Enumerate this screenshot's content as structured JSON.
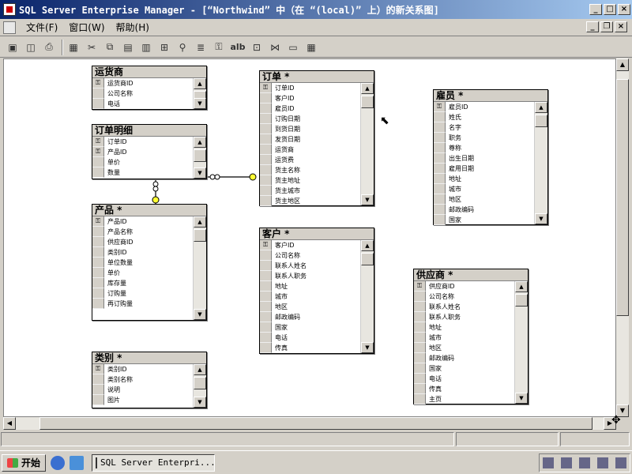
{
  "window": {
    "title": "SQL Server Enterprise Manager - [“Northwind” 中（在 “(local)” 上）的新关系图]",
    "min": "_",
    "max": "□",
    "close": "×"
  },
  "menu": {
    "items": [
      "文件(F)",
      "窗口(W)",
      "帮助(H)"
    ]
  },
  "mdi": {
    "min": "_",
    "restore": "❐",
    "close": "×"
  },
  "toolbar": {
    "icons": [
      "save-icon",
      "properties-icon",
      "print-icon",
      "new-table-icon",
      "cut-icon",
      "copy-icon",
      "paste-icon",
      "add-table-icon",
      "add-related-icon",
      "zoom-icon",
      "script-icon",
      "key-icon",
      "label-icon",
      "arrange-icon",
      "relationship-icon",
      "table-view-icon",
      "grid-icon"
    ],
    "label_text": "alb"
  },
  "tables": [
    {
      "id": "t-shippers",
      "name": "运货商",
      "columns": [
        "运货商ID",
        "公司名称",
        "电话"
      ],
      "keys": [
        0
      ]
    },
    {
      "id": "t-orderdetails",
      "name": "订单明细",
      "columns": [
        "订单ID",
        "产品ID",
        "单价",
        "数量"
      ],
      "keys": [
        0,
        1
      ]
    },
    {
      "id": "t-products",
      "name": "产品 *",
      "columns": [
        "产品ID",
        "产品名称",
        "供应商ID",
        "类别ID",
        "单位数量",
        "单价",
        "库存量",
        "订购量",
        "再订购量"
      ],
      "keys": [
        0
      ]
    },
    {
      "id": "t-categories",
      "name": "类别 *",
      "columns": [
        "类别ID",
        "类别名称",
        "说明",
        "图片"
      ],
      "keys": [
        0
      ]
    },
    {
      "id": "t-orders",
      "name": "订单 *",
      "columns": [
        "订单ID",
        "客户ID",
        "雇员ID",
        "订购日期",
        "到货日期",
        "发货日期",
        "运货商",
        "运货费",
        "货主名称",
        "货主地址",
        "货主城市",
        "货主地区"
      ],
      "keys": [
        0
      ]
    },
    {
      "id": "t-customers",
      "name": "客户 *",
      "columns": [
        "客户ID",
        "公司名称",
        "联系人姓名",
        "联系人职务",
        "地址",
        "城市",
        "地区",
        "邮政编码",
        "国家",
        "电话",
        "传真"
      ],
      "keys": [
        0
      ]
    },
    {
      "id": "t-employees",
      "name": "雇员 *",
      "columns": [
        "雇员ID",
        "姓氏",
        "名字",
        "职务",
        "尊称",
        "出生日期",
        "雇用日期",
        "地址",
        "城市",
        "地区",
        "邮政编码",
        "国家"
      ],
      "keys": [
        0
      ]
    },
    {
      "id": "t-suppliers",
      "name": "供应商 *",
      "columns": [
        "供应商ID",
        "公司名称",
        "联系人姓名",
        "联系人职务",
        "地址",
        "城市",
        "地区",
        "邮政编码",
        "国家",
        "电话",
        "传真",
        "主页"
      ],
      "keys": [
        0
      ]
    }
  ],
  "taskbar": {
    "start": "开始",
    "task": "SQL Server Enterpri..."
  }
}
